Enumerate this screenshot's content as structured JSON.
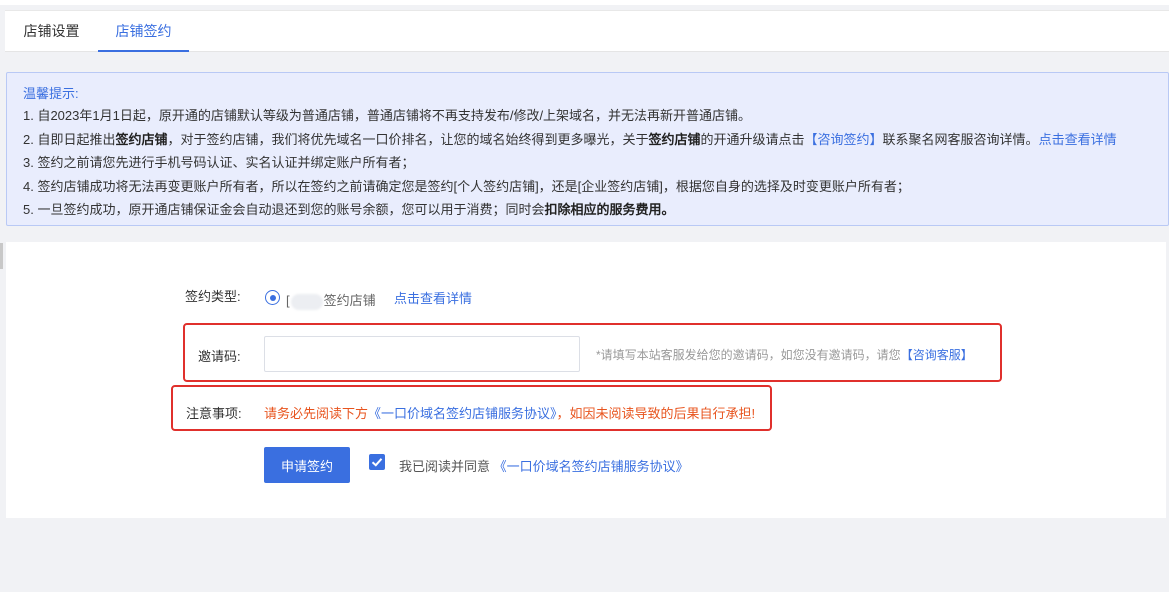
{
  "tabs": [
    {
      "label": "店铺设置",
      "active": false
    },
    {
      "label": "店铺签约",
      "active": true
    }
  ],
  "notice": {
    "title": "温馨提示:",
    "line1": "1. 自2023年1月1日起，原开通的店铺默认等级为普通店铺，普通店铺将不再支持发布/修改/上架域名，并无法再新开普通店铺。",
    "line2_a": "2. 自即日起推出",
    "line2_b": "签约店铺",
    "line2_c": "，对于签约店铺，我们将优先域名一口价排名，让您的域名始终得到更多曝光，关于",
    "line2_d": "签约店铺",
    "line2_e": "的开通升级请点击",
    "line2_link1": "【咨询签约】",
    "line2_f": "联系聚名网客服咨询详情。",
    "line2_link2": "点击查看详情",
    "line3": "3. 签约之前请您先进行手机号码认证、实名认证并绑定账户所有者；",
    "line4": "4. 签约店铺成功将无法再变更账户所有者，所以在签约之前请确定您是签约[个人签约店铺]，还是[企业签约店铺]，根据您自身的选择及时变更账户所有者；",
    "line5_a": "5. 一旦签约成功，原开通店铺保证金会自动退还到您的账号余额，您可以用于消费；同时会",
    "line5_b": "扣除相应的服务费用。"
  },
  "form": {
    "sign_type_label": "签约类型:",
    "sign_type_prefix": "[",
    "sign_type_suffix": "签约店铺",
    "detail_link": "点击查看详情",
    "invite_label": "邀请码:",
    "invite_value": "",
    "invite_placeholder": "",
    "invite_hint": "*请填写本站客服发给您的邀请码，如您没有邀请码，请您",
    "invite_hint_link": "【咨询客服】",
    "note_label": "注意事项:",
    "note_a": "请务必先阅读下方",
    "note_link": "《一口价域名签约店铺服务协议》",
    "note_b": "，如因未阅读导致的后果自行承担!",
    "submit_label": "申请签约",
    "agree_text": "我已阅读并同意",
    "agree_link": "《一口价域名签约店铺服务协议》",
    "agree_checked": true
  },
  "colors": {
    "accent": "#3a6fe0",
    "warning": "#e8541e",
    "highlight_box": "#e0302c"
  }
}
